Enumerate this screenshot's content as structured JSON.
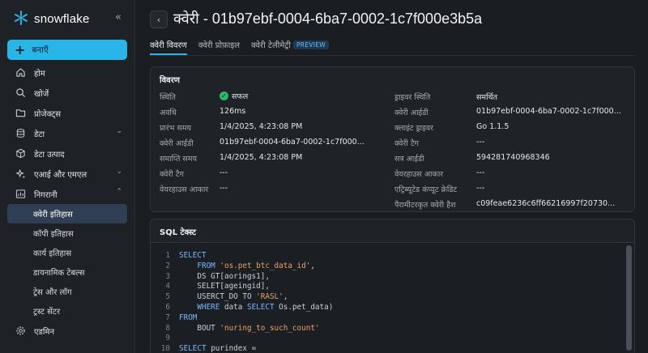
{
  "sidebar": {
    "brand": "snowflake",
    "collapse_icon": "chevrons-left-icon",
    "create_label": "बनाएँ",
    "items": [
      {
        "label": "होम",
        "icon": "home-icon"
      },
      {
        "label": "खोजें",
        "icon": "search-icon"
      },
      {
        "label": "प्रोजेक्ट्स",
        "icon": "folder-icon"
      },
      {
        "label": "डेटा",
        "icon": "database-icon"
      },
      {
        "label": "डेटा उत्पाद",
        "icon": "cube-icon"
      },
      {
        "label": "एआई और एमएल",
        "icon": "sparkle-icon"
      },
      {
        "label": "निगरानी",
        "icon": "monitor-icon"
      }
    ],
    "monitoring_sub": [
      "क्वेरी इतिहास",
      "कॉपी इतिहास",
      "कार्य इतिहास",
      "डायनामिक टेबल्स",
      "ट्रेस और लॉग",
      "ट्रस्ट सेंटर"
    ],
    "admin_label": "एडमिन"
  },
  "header": {
    "title": "क्वेरी - 01b97ebf-0004-6ba7-0002-1c7f000e3b5a",
    "tabs": [
      "क्वेरी विवरण",
      "क्वेरी प्रोफ़ाइल",
      "क्वेरी टेलीमेट्री"
    ],
    "preview_badge": "PREVIEW"
  },
  "details": {
    "title": "विवरण",
    "left": [
      {
        "k": "स्थिति",
        "v": "सफल"
      },
      {
        "k": "अवधि",
        "v": "126ms"
      },
      {
        "k": "प्रारंभ समय",
        "v": "1/4/2025, 4:23:08 PM"
      },
      {
        "k": "क्वेरी आईडी",
        "v": "01b97ebf-0004-6ba7-0002-1c7f000..."
      },
      {
        "k": "समाप्ति समय",
        "v": "1/4/2025, 4:23:08 PM"
      },
      {
        "k": "क्वेरी टैग",
        "v": "---"
      },
      {
        "k": "वेयरहाउस आकार",
        "v": "---"
      }
    ],
    "right": [
      {
        "k": "ड्राइवर स्थिति",
        "v": "समर्थित"
      },
      {
        "k": "क्वेरी आईडी",
        "v": "01b97ebf-0004-6ba7-0002-1c7f000..."
      },
      {
        "k": "क्लाइंट ड्राइवर",
        "v": "Go 1.1.5"
      },
      {
        "k": "क्वेरी टैग",
        "v": "---"
      },
      {
        "k": "सत्र आईडी",
        "v": "594281740968346"
      },
      {
        "k": "वेयरहाउस आकार",
        "v": "---"
      },
      {
        "k": "एट्रिब्यूटेड कंप्यूट क्रेडिट",
        "v": "---"
      },
      {
        "k": "पैरामीटरकृत क्वेरी हैश",
        "v": "c09feae6236c6ff66216997f20730..."
      }
    ]
  },
  "sql": {
    "title": "SQL टेक्स्ट",
    "lines": [
      {
        "n": "1",
        "parts": [
          {
            "t": "SELECT",
            "c": "kw"
          }
        ]
      },
      {
        "n": "2",
        "parts": [
          {
            "t": "    FROM ",
            "c": "kw"
          },
          {
            "t": "'os.pet_btc_data_id'",
            "c": "str"
          },
          {
            "t": ",",
            "c": ""
          }
        ]
      },
      {
        "n": "3",
        "parts": [
          {
            "t": "    DS GT[aorings1],",
            "c": ""
          }
        ]
      },
      {
        "n": "4",
        "parts": [
          {
            "t": "    SELET[ageingid],",
            "c": ""
          }
        ]
      },
      {
        "n": "5",
        "parts": [
          {
            "t": "    USERCT_DO TO ",
            "c": ""
          },
          {
            "t": "'RASL'",
            "c": "str"
          },
          {
            "t": ",",
            "c": ""
          }
        ]
      },
      {
        "n": "6",
        "parts": [
          {
            "t": "    WHERE",
            "c": "kw"
          },
          {
            "t": " data ",
            "c": ""
          },
          {
            "t": "SELECT",
            "c": "kw"
          },
          {
            "t": " Os.pet_data)",
            "c": ""
          }
        ]
      },
      {
        "n": "7",
        "parts": [
          {
            "t": "FROM",
            "c": "kw"
          }
        ]
      },
      {
        "n": "8",
        "parts": [
          {
            "t": "    BOUT ",
            "c": ""
          },
          {
            "t": "'nuring_to_such_count'",
            "c": "str"
          }
        ]
      },
      {
        "n": "9",
        "parts": [
          {
            "t": "",
            "c": ""
          }
        ]
      },
      {
        "n": "10",
        "parts": [
          {
            "t": "SELECT",
            "c": "kw"
          },
          {
            "t": " purindex =",
            "c": ""
          }
        ]
      }
    ]
  },
  "colors": {
    "accent": "#29b5e8",
    "success": "#2fb86a"
  }
}
